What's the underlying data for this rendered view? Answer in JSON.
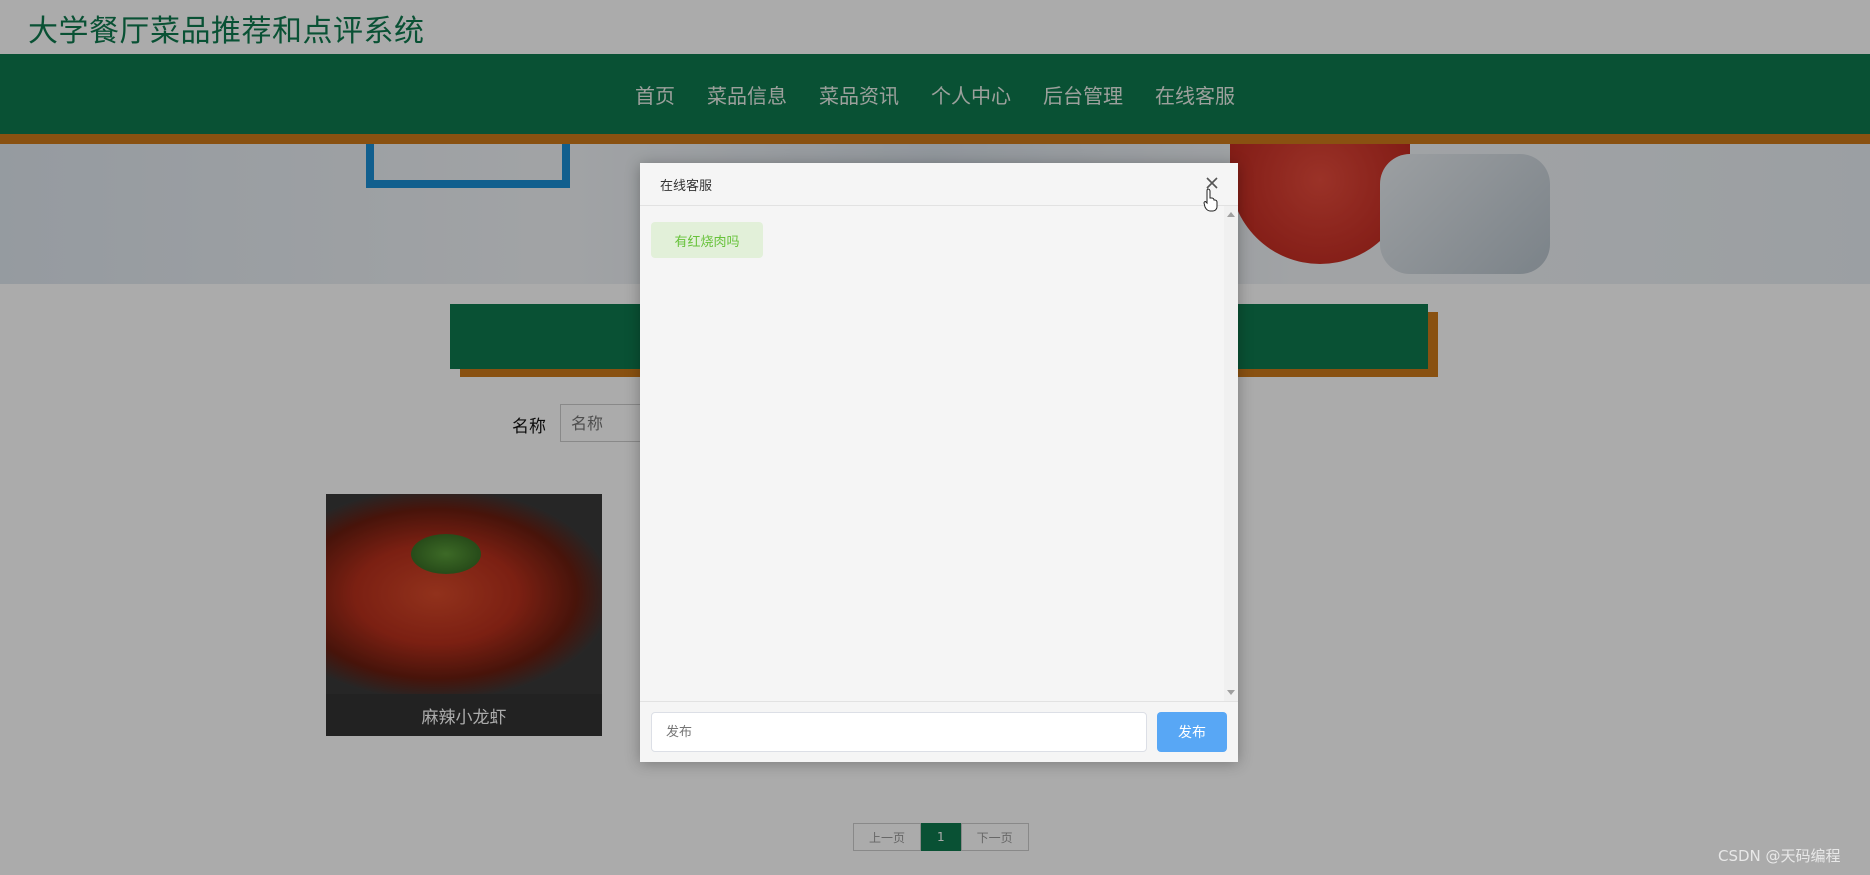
{
  "header": {
    "site_title": "大学餐厅菜品推荐和点评系统"
  },
  "nav": {
    "items": [
      {
        "label": "首页"
      },
      {
        "label": "菜品信息"
      },
      {
        "label": "菜品资讯"
      },
      {
        "label": "个人中心"
      },
      {
        "label": "后台管理"
      },
      {
        "label": "在线客服"
      }
    ]
  },
  "search": {
    "label": "名称",
    "placeholder": "名称"
  },
  "products": [
    {
      "name": "麻辣小龙虾"
    }
  ],
  "pagination": {
    "prev": "上一页",
    "current": "1",
    "next": "下一页"
  },
  "dialog": {
    "title": "在线客服",
    "messages": [
      {
        "text": "有红烧肉吗"
      }
    ],
    "input_placeholder": "发布",
    "send_label": "发布"
  },
  "watermark": "CSDN @天码编程",
  "colors": {
    "brand_green": "#0e7a4e",
    "accent_orange": "#cc7a1a",
    "send_blue": "#58a7f5",
    "bubble_bg": "#e2f0d9",
    "bubble_text": "#67c23a"
  }
}
